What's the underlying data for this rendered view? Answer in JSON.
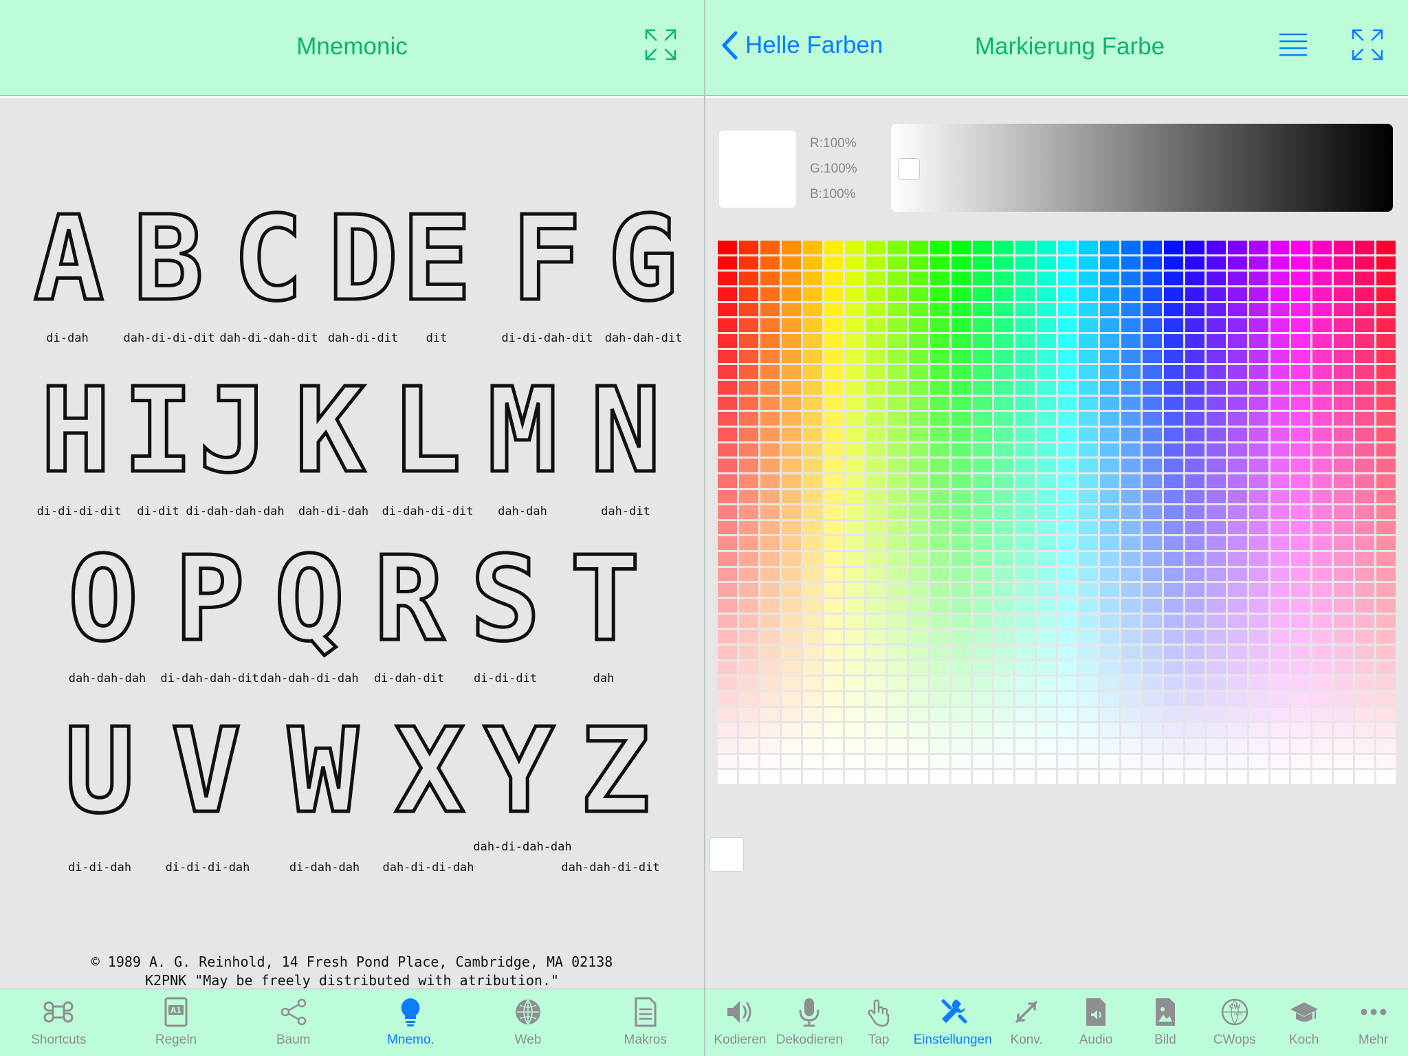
{
  "left": {
    "title": "Mnemonic",
    "icons": {
      "expand": "expand-icon"
    }
  },
  "right": {
    "back_label": "Helle Farben",
    "title": "Markierung Farbe",
    "icons": {
      "menu": "hamburger-icon",
      "expand": "expand-icon"
    },
    "rgb": {
      "r": "R:100%",
      "g": "G:100%",
      "b": "B:100%"
    },
    "selected_color": "#FFFFFF"
  },
  "mnemonic": {
    "rows": [
      {
        "letters": [
          "A",
          "B",
          "C",
          "D",
          "E",
          "F",
          "G"
        ],
        "labels": [
          "di-dah",
          "dah-di-di-dit",
          "dah-di-dah-dit",
          "dah-di-dit",
          "dit",
          "di-di-dah-dit",
          "dah-dah-dit"
        ]
      },
      {
        "letters": [
          "H",
          "I",
          "J",
          "K",
          "L",
          "M",
          "N"
        ],
        "labels": [
          "di-di-di-dit",
          "di-dit",
          "di-dah-dah-dah",
          "dah-di-dah",
          "di-dah-di-dit",
          "dah-dah",
          "dah-dit"
        ]
      },
      {
        "letters": [
          "O",
          "P",
          "Q",
          "R",
          "S",
          "T"
        ],
        "labels": [
          "dah-dah-dah",
          "di-dah-dah-dit",
          "dah-dah-di-dah",
          "di-dah-dit",
          "di-di-dit",
          "dah"
        ]
      },
      {
        "letters": [
          "U",
          "V",
          "W",
          "X",
          "Y",
          "Z"
        ],
        "labels": [
          "di-di-dah",
          "di-di-di-dah",
          "di-dah-dah",
          "dah-di-di-dah",
          "dah-di-dah-dah",
          "dah-dah-di-dit"
        ]
      }
    ],
    "copyright_1": "© 1989 A. G. Reinhold, 14 Fresh Pond Place, Cambridge, MA 02138",
    "copyright_2": "K2PNK  \"May be freely distributed with atribution.\""
  },
  "left_tabs": [
    {
      "label": "Shortcuts",
      "icon": "command-icon",
      "active": false
    },
    {
      "label": "Regeln",
      "icon": "document-a1-icon",
      "active": false
    },
    {
      "label": "Baum",
      "icon": "share-tree-icon",
      "active": false
    },
    {
      "label": "Mnemo.",
      "icon": "lightbulb-icon",
      "active": true
    },
    {
      "label": "Web",
      "icon": "globe-icon",
      "active": false
    },
    {
      "label": "Makros",
      "icon": "document-lines-icon",
      "active": false
    }
  ],
  "right_tabs": [
    {
      "label": "Kodieren",
      "icon": "speaker-icon",
      "active": false
    },
    {
      "label": "Dekodieren",
      "icon": "microphone-icon",
      "active": false
    },
    {
      "label": "Tap",
      "icon": "hand-tap-icon",
      "active": false
    },
    {
      "label": "Einstellungen",
      "icon": "tools-icon",
      "active": true
    },
    {
      "label": "Konv.",
      "icon": "convert-arrows-icon",
      "active": false
    },
    {
      "label": "Audio",
      "icon": "audio-file-icon",
      "active": false
    },
    {
      "label": "Bild",
      "icon": "image-file-icon",
      "active": false
    },
    {
      "label": "CWops",
      "icon": "cwops-logo-icon",
      "active": false
    },
    {
      "label": "Koch",
      "icon": "graduation-cap-icon",
      "active": false
    },
    {
      "label": "Mehr",
      "icon": "more-dots-icon",
      "active": false
    }
  ],
  "colors": {
    "accent": "#0A7CFF",
    "title_green": "#0BB36E",
    "bar_bg": "#BDFCD8",
    "inactive": "#8E8E93"
  }
}
